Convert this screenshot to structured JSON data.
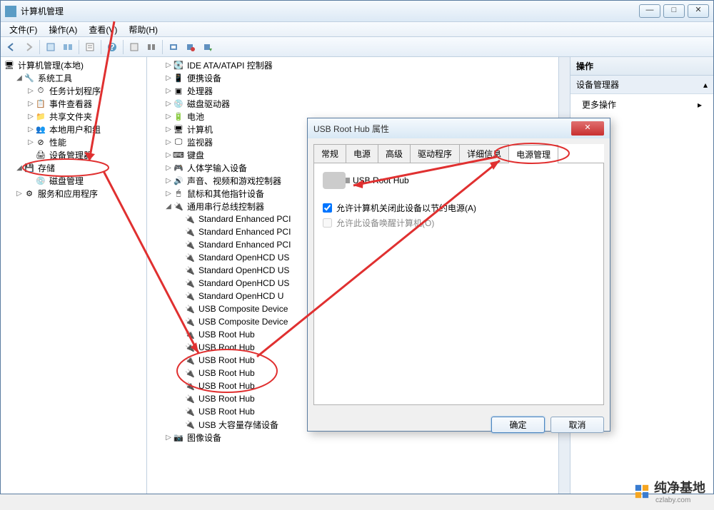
{
  "titlebar": {
    "title": "计算机管理"
  },
  "menubar": {
    "items": [
      "文件(F)",
      "操作(A)",
      "查看(V)",
      "帮助(H)"
    ]
  },
  "left_tree": {
    "root": "计算机管理(本地)",
    "system_tools": {
      "label": "系统工具",
      "children": [
        "任务计划程序",
        "事件查看器",
        "共享文件夹",
        "本地用户和组",
        "性能",
        "设备管理器"
      ]
    },
    "storage": {
      "label": "存储",
      "children": [
        "磁盘管理"
      ]
    },
    "services": {
      "label": "服务和应用程序"
    }
  },
  "mid_tree": {
    "items_top": [
      "IDE ATA/ATAPI 控制器",
      "便携设备",
      "处理器",
      "磁盘驱动器",
      "电池",
      "计算机",
      "监视器",
      "键盘",
      "人体学输入设备",
      "声音、视频和游戏控制器",
      "鼠标和其他指针设备"
    ],
    "usb_controller": {
      "label": "通用串行总线控制器",
      "children": [
        "Standard Enhanced PCI",
        "Standard Enhanced PCI",
        "Standard Enhanced PCI",
        "Standard OpenHCD US",
        "Standard OpenHCD US",
        "Standard OpenHCD US",
        "Standard OpenHCD U",
        "USB Composite Device",
        "USB Composite Device",
        "USB Root Hub",
        "USB Root Hub",
        "USB Root Hub",
        "USB Root Hub",
        "USB Root Hub",
        "USB Root Hub",
        "USB Root Hub",
        "USB 大容量存储设备"
      ]
    },
    "image_devices": "图像设备"
  },
  "right_pane": {
    "header": "操作",
    "section": "设备管理器",
    "item": "更多操作"
  },
  "dialog": {
    "title": "USB Root Hub 属性",
    "tabs": [
      "常规",
      "电源",
      "高级",
      "驱动程序",
      "详细信息",
      "电源管理"
    ],
    "active_tab": 5,
    "device_name": "USB Root Hub",
    "checkbox1": "允许计算机关闭此设备以节约电源(A)",
    "checkbox1_checked": true,
    "checkbox2": "允许此设备唤醒计算机(O)",
    "checkbox2_checked": false,
    "ok": "确定",
    "cancel": "取消"
  },
  "watermark": {
    "text": "纯净基地",
    "sub": "czlaby.com"
  }
}
